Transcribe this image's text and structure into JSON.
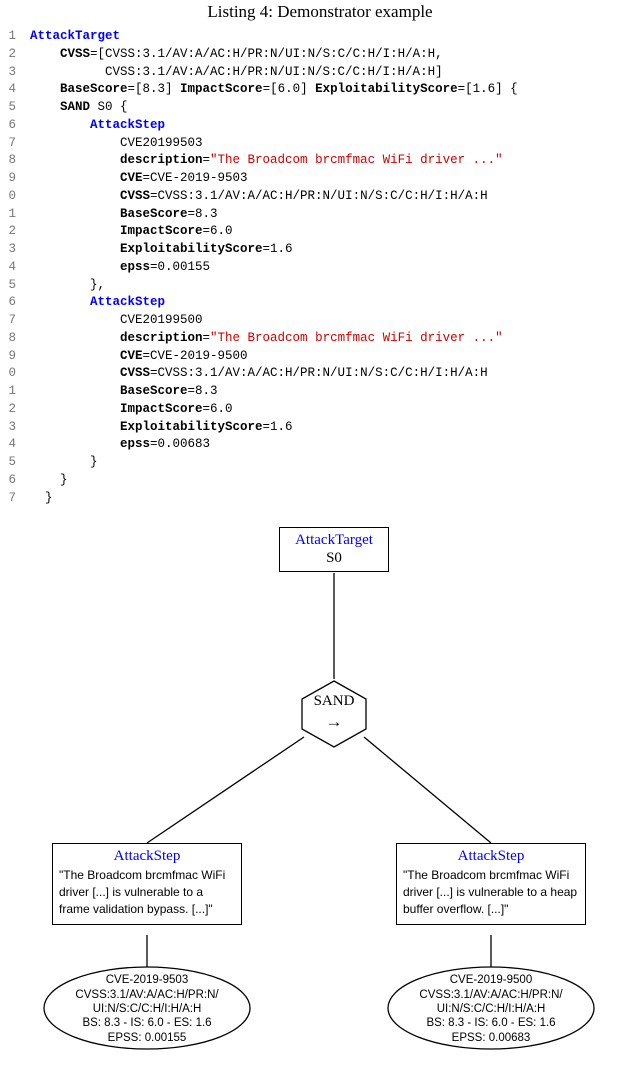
{
  "caption": "Listing 4: Demonstrator example",
  "code": {
    "lines": [
      {
        "n": "1",
        "parts": [
          {
            "t": "AttackTarget",
            "c": "kw-blue"
          }
        ]
      },
      {
        "n": "2",
        "parts": [
          {
            "t": "    ",
            "c": ""
          },
          {
            "t": "CVSS",
            "c": "bold"
          },
          {
            "t": "=[CVSS:3.1/AV:A/AC:H/PR:N/UI:N/S:C/C:H/I:H/A:H,",
            "c": ""
          }
        ]
      },
      {
        "n": "3",
        "parts": [
          {
            "t": "          CVSS:3.1/AV:A/AC:H/PR:N/UI:N/S:C/C:H/I:H/A:H]",
            "c": ""
          }
        ]
      },
      {
        "n": "4",
        "parts": [
          {
            "t": "    ",
            "c": ""
          },
          {
            "t": "BaseScore",
            "c": "bold"
          },
          {
            "t": "=[8.3] ",
            "c": ""
          },
          {
            "t": "ImpactScore",
            "c": "bold"
          },
          {
            "t": "=[6.0] ",
            "c": ""
          },
          {
            "t": "ExploitabilityScore",
            "c": "bold"
          },
          {
            "t": "=[1.6] {",
            "c": ""
          }
        ]
      },
      {
        "n": "5",
        "parts": [
          {
            "t": "    ",
            "c": ""
          },
          {
            "t": "SAND",
            "c": "bold"
          },
          {
            "t": " S0 {",
            "c": ""
          }
        ]
      },
      {
        "n": "6",
        "parts": [
          {
            "t": "        ",
            "c": ""
          },
          {
            "t": "AttackStep",
            "c": "kw-blue"
          }
        ]
      },
      {
        "n": "7",
        "parts": [
          {
            "t": "            CVE20199503",
            "c": ""
          }
        ]
      },
      {
        "n": "8",
        "parts": [
          {
            "t": "            ",
            "c": ""
          },
          {
            "t": "description",
            "c": "bold"
          },
          {
            "t": "=",
            "c": ""
          },
          {
            "t": "\"The Broadcom brcmfmac WiFi driver ...\"",
            "c": "str"
          }
        ]
      },
      {
        "n": "9",
        "parts": [
          {
            "t": "            ",
            "c": ""
          },
          {
            "t": "CVE",
            "c": "bold"
          },
          {
            "t": "=CVE-2019-9503",
            "c": ""
          }
        ]
      },
      {
        "n": "0",
        "parts": [
          {
            "t": "            ",
            "c": ""
          },
          {
            "t": "CVSS",
            "c": "bold"
          },
          {
            "t": "=CVSS:3.1/AV:A/AC:H/PR:N/UI:N/S:C/C:H/I:H/A:H",
            "c": ""
          }
        ]
      },
      {
        "n": "1",
        "parts": [
          {
            "t": "            ",
            "c": ""
          },
          {
            "t": "BaseScore",
            "c": "bold"
          },
          {
            "t": "=8.3",
            "c": ""
          }
        ]
      },
      {
        "n": "2",
        "parts": [
          {
            "t": "            ",
            "c": ""
          },
          {
            "t": "ImpactScore",
            "c": "bold"
          },
          {
            "t": "=6.0",
            "c": ""
          }
        ]
      },
      {
        "n": "3",
        "parts": [
          {
            "t": "            ",
            "c": ""
          },
          {
            "t": "ExploitabilityScore",
            "c": "bold"
          },
          {
            "t": "=1.6",
            "c": ""
          }
        ]
      },
      {
        "n": "4",
        "parts": [
          {
            "t": "            ",
            "c": ""
          },
          {
            "t": "epss",
            "c": "bold"
          },
          {
            "t": "=0.00155",
            "c": ""
          }
        ]
      },
      {
        "n": "5",
        "parts": [
          {
            "t": "        },",
            "c": ""
          }
        ]
      },
      {
        "n": "6",
        "parts": [
          {
            "t": "        ",
            "c": ""
          },
          {
            "t": "AttackStep",
            "c": "kw-blue"
          }
        ]
      },
      {
        "n": "7",
        "parts": [
          {
            "t": "            CVE20199500",
            "c": ""
          }
        ]
      },
      {
        "n": "8",
        "parts": [
          {
            "t": "            ",
            "c": ""
          },
          {
            "t": "description",
            "c": "bold"
          },
          {
            "t": "=",
            "c": ""
          },
          {
            "t": "\"The Broadcom brcmfmac WiFi driver ...\"",
            "c": "str"
          }
        ]
      },
      {
        "n": "9",
        "parts": [
          {
            "t": "            ",
            "c": ""
          },
          {
            "t": "CVE",
            "c": "bold"
          },
          {
            "t": "=CVE-2019-9500",
            "c": ""
          }
        ]
      },
      {
        "n": "0",
        "parts": [
          {
            "t": "            ",
            "c": ""
          },
          {
            "t": "CVSS",
            "c": "bold"
          },
          {
            "t": "=CVSS:3.1/AV:A/AC:H/PR:N/UI:N/S:C/C:H/I:H/A:H",
            "c": ""
          }
        ]
      },
      {
        "n": "1",
        "parts": [
          {
            "t": "            ",
            "c": ""
          },
          {
            "t": "BaseScore",
            "c": "bold"
          },
          {
            "t": "=8.3",
            "c": ""
          }
        ]
      },
      {
        "n": "2",
        "parts": [
          {
            "t": "            ",
            "c": ""
          },
          {
            "t": "ImpactScore",
            "c": "bold"
          },
          {
            "t": "=6.0",
            "c": ""
          }
        ]
      },
      {
        "n": "3",
        "parts": [
          {
            "t": "            ",
            "c": ""
          },
          {
            "t": "ExploitabilityScore",
            "c": "bold"
          },
          {
            "t": "=1.6",
            "c": ""
          }
        ]
      },
      {
        "n": "4",
        "parts": [
          {
            "t": "            ",
            "c": ""
          },
          {
            "t": "epss",
            "c": "bold"
          },
          {
            "t": "=0.00683",
            "c": ""
          }
        ]
      },
      {
        "n": "5",
        "parts": [
          {
            "t": "        }",
            "c": ""
          }
        ]
      },
      {
        "n": "6",
        "parts": [
          {
            "t": "    }",
            "c": ""
          }
        ]
      },
      {
        "n": "7",
        "parts": [
          {
            "t": "  }",
            "c": ""
          }
        ]
      }
    ]
  },
  "diagram": {
    "target": {
      "title": "AttackTarget",
      "name": "S0"
    },
    "gate": {
      "label": "SAND",
      "arrow": "→"
    },
    "stepLeft": {
      "title": "AttackStep",
      "body": "\"The Broadcom brcmfmac WiFi driver [...] is vulnerable to a frame validation bypass. [...]\""
    },
    "stepRight": {
      "title": "AttackStep",
      "body": "\"The Broadcom brcmfmac WiFi driver [...] is vulnerable to a heap buffer overflow. [...]\""
    },
    "ovalLeft": {
      "l1": "CVE-2019-9503",
      "l2": "CVSS:3.1/AV:A/AC:H/PR:N/",
      "l3": "UI:N/S:C/C:H/I:H/A:H",
      "l4": "BS: 8.3 - IS: 6.0 - ES: 1.6",
      "l5": "EPSS: 0.00155"
    },
    "ovalRight": {
      "l1": "CVE-2019-9500",
      "l2": "CVSS:3.1/AV:A/AC:H/PR:N/",
      "l3": "UI:N/S:C/C:H/I:H/A:H",
      "l4": "BS: 8.3 - IS: 6.0 - ES: 1.6",
      "l5": "EPSS: 0.00683"
    }
  }
}
